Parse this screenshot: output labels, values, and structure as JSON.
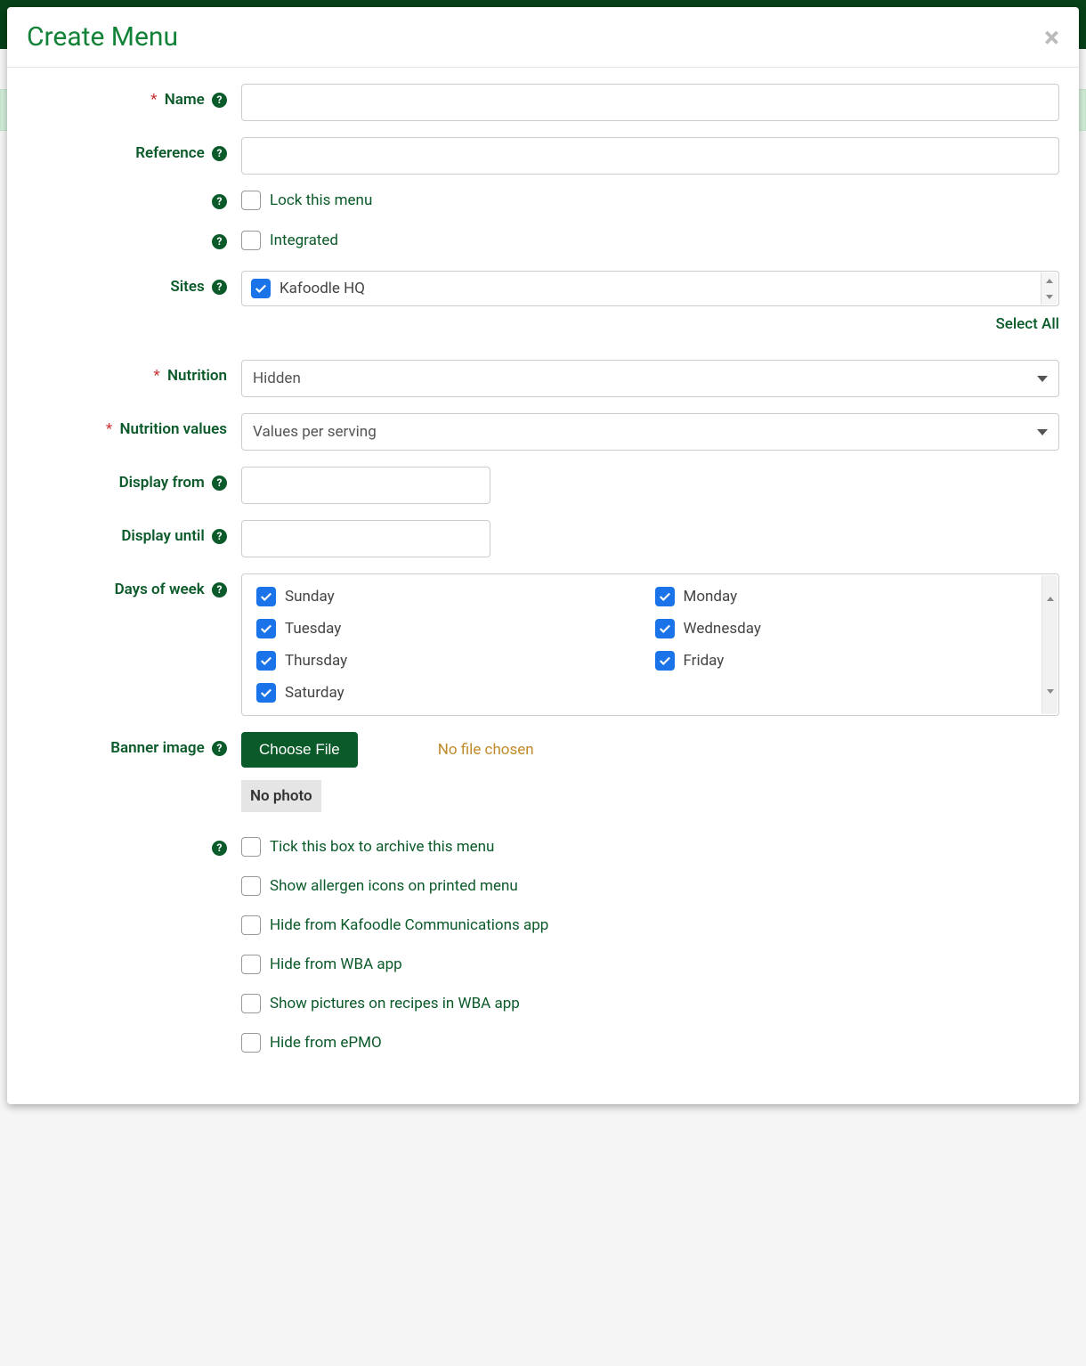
{
  "modal": {
    "title": "Create Menu"
  },
  "fields": {
    "name": {
      "label": "Name",
      "required": true,
      "value": ""
    },
    "reference": {
      "label": "Reference",
      "required": false,
      "value": ""
    },
    "lock": {
      "label": "Lock this menu",
      "checked": false
    },
    "integrated": {
      "label": "Integrated",
      "checked": false
    },
    "sites": {
      "label": "Sites",
      "items": [
        {
          "name": "Kafoodle HQ",
          "checked": true
        }
      ],
      "select_all": "Select All"
    },
    "nutrition": {
      "label": "Nutrition",
      "required": true,
      "value": "Hidden"
    },
    "nutrition_values": {
      "label": "Nutrition values",
      "required": true,
      "value": "Values per serving"
    },
    "display_from": {
      "label": "Display from",
      "value": ""
    },
    "display_until": {
      "label": "Display until",
      "value": ""
    },
    "days": {
      "label": "Days of week",
      "items": [
        {
          "name": "Sunday",
          "checked": true
        },
        {
          "name": "Monday",
          "checked": true
        },
        {
          "name": "Tuesday",
          "checked": true
        },
        {
          "name": "Wednesday",
          "checked": true
        },
        {
          "name": "Thursday",
          "checked": true
        },
        {
          "name": "Friday",
          "checked": true
        },
        {
          "name": "Saturday",
          "checked": true
        }
      ]
    },
    "banner": {
      "label": "Banner image",
      "button": "Choose File",
      "status": "No file chosen",
      "placeholder": "No photo"
    },
    "archive": {
      "label": "Tick this box to archive this menu",
      "checked": false
    },
    "allergen": {
      "label": "Show allergen icons on printed menu",
      "checked": false
    },
    "hide_comms": {
      "label": "Hide from Kafoodle Communications app",
      "checked": false
    },
    "hide_wba": {
      "label": "Hide from WBA app",
      "checked": false
    },
    "show_pics": {
      "label": "Show pictures on recipes in WBA app",
      "checked": false
    },
    "hide_epmo": {
      "label": "Hide from ePMO",
      "checked": false
    }
  }
}
